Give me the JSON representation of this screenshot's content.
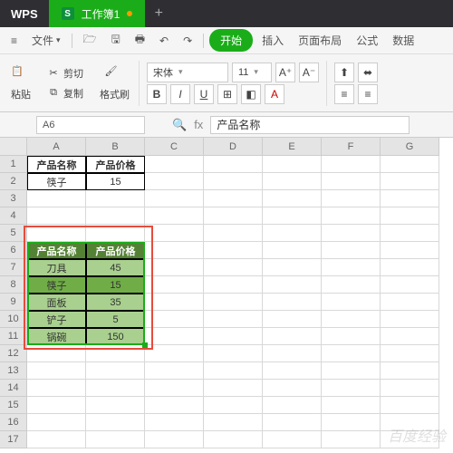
{
  "titlebar": {
    "logo": "WPS",
    "tab": "工作簿1",
    "newtab": "+"
  },
  "menubar": {
    "file": "文件",
    "start": "开始",
    "insert": "插入",
    "layout": "页面布局",
    "formula": "公式",
    "data": "数据"
  },
  "toolbar": {
    "paste": "粘贴",
    "cut": "剪切",
    "copy": "复制",
    "format": "格式刷",
    "font": "宋体",
    "size": "11",
    "bold": "B",
    "italic": "I",
    "underline": "U",
    "a_sup": "A⁺",
    "a_sub": "A⁻"
  },
  "formula": {
    "namebox": "A6",
    "fx": "fx",
    "value": "产品名称"
  },
  "cols": [
    "A",
    "B",
    "C",
    "D",
    "E",
    "F",
    "G"
  ],
  "rows": [
    "1",
    "2",
    "3",
    "4",
    "5",
    "6",
    "7",
    "8",
    "9",
    "10",
    "11",
    "12",
    "13",
    "14",
    "15",
    "16",
    "17"
  ],
  "table1": {
    "h1": "产品名称",
    "h2": "产品价格",
    "r1c1": "筷子",
    "r1c2": "15"
  },
  "table2": {
    "h1": "产品名称",
    "h2": "产品价格",
    "rows": [
      {
        "n": "刀具",
        "p": "45"
      },
      {
        "n": "筷子",
        "p": "15"
      },
      {
        "n": "面板",
        "p": "35"
      },
      {
        "n": "铲子",
        "p": "5"
      },
      {
        "n": "锅碗",
        "p": "150"
      }
    ]
  },
  "chart_data": {
    "type": "table",
    "title": "产品价格",
    "series": [
      {
        "name": "产品价格",
        "values": [
          45,
          15,
          35,
          5,
          150
        ]
      }
    ],
    "categories": [
      "刀具",
      "筷子",
      "面板",
      "铲子",
      "锅碗"
    ]
  },
  "watermark": "百度经验"
}
